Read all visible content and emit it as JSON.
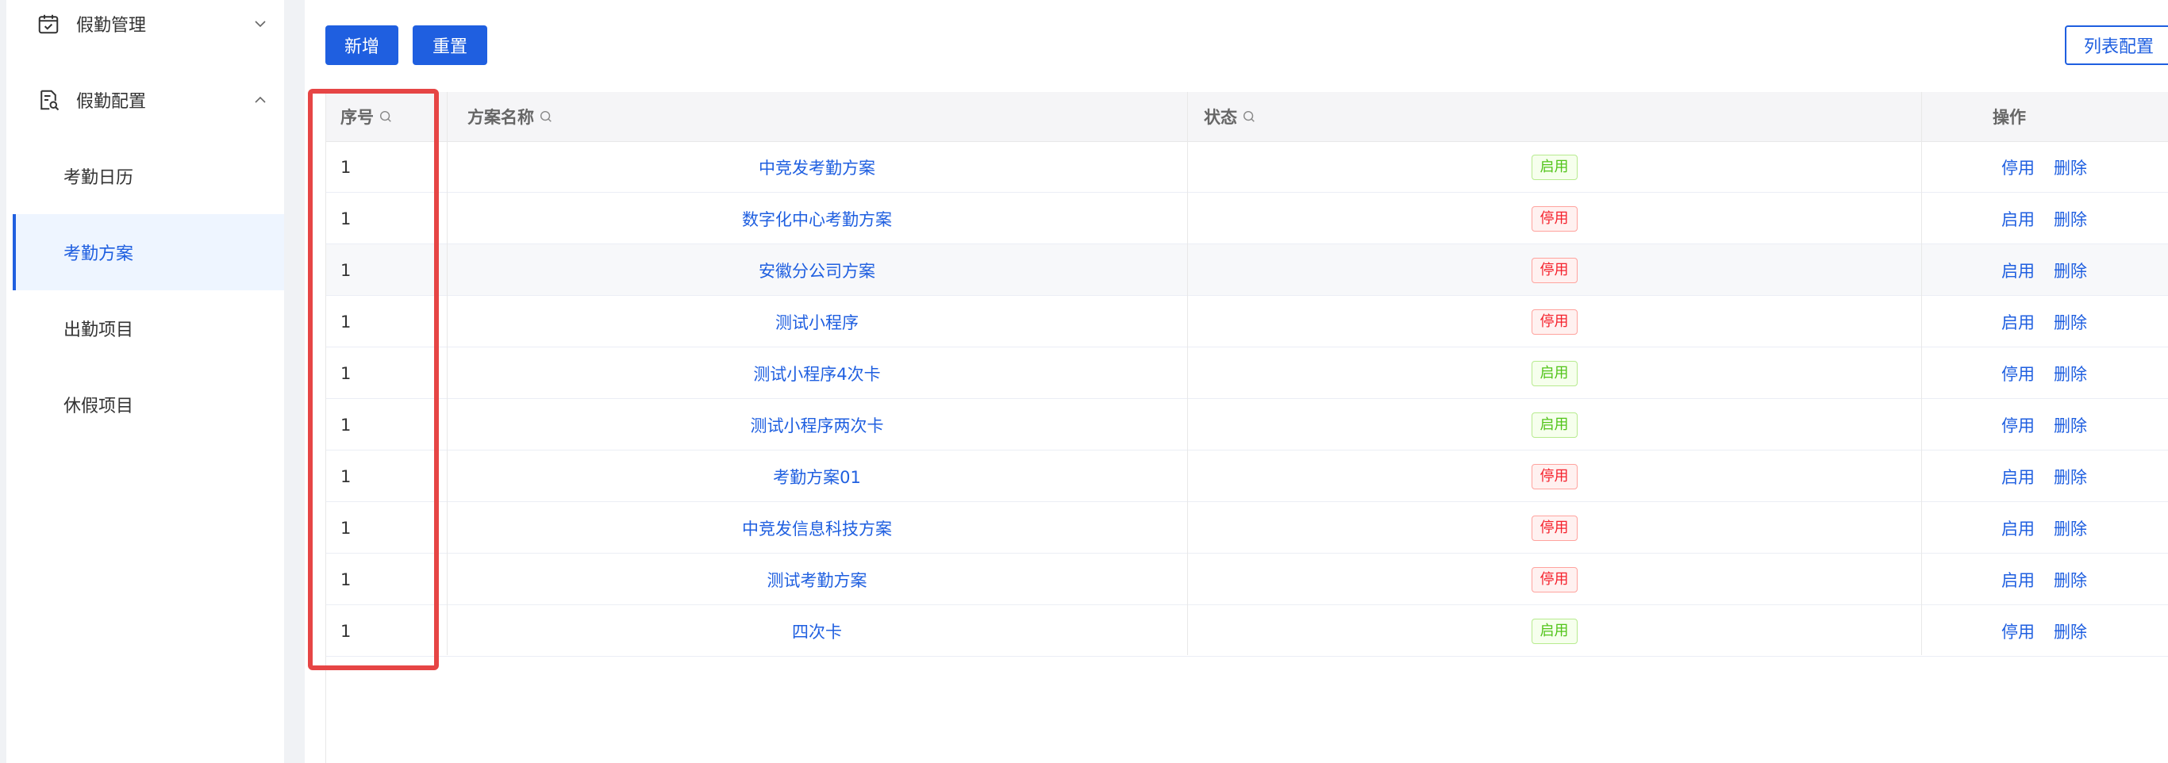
{
  "sidebar": {
    "groups": [
      {
        "label": "假勤管理",
        "icon": "calendar-check-icon",
        "chevron": "chevron-down-icon"
      },
      {
        "label": "假勤配置",
        "icon": "document-search-icon",
        "chevron": "chevron-up-icon"
      }
    ],
    "items": [
      {
        "label": "考勤日历",
        "active": false
      },
      {
        "label": "考勤方案",
        "active": true
      },
      {
        "label": "出勤项目",
        "active": false
      },
      {
        "label": "休假项目",
        "active": false
      }
    ]
  },
  "toolbar": {
    "add_label": "新增",
    "reset_label": "重置",
    "list_config_label": "列表配置"
  },
  "table": {
    "headers": {
      "seq": "序号",
      "name": "方案名称",
      "status": "状态",
      "ops": "操作"
    },
    "rows": [
      {
        "seq": "1",
        "name": "中竞发考勤方案",
        "status": "启用",
        "status_on": true,
        "toggle": "停用",
        "del": "删除"
      },
      {
        "seq": "1",
        "name": "数字化中心考勤方案",
        "status": "停用",
        "status_on": false,
        "toggle": "启用",
        "del": "删除"
      },
      {
        "seq": "1",
        "name": "安徽分公司方案",
        "status": "停用",
        "status_on": false,
        "toggle": "启用",
        "del": "删除"
      },
      {
        "seq": "1",
        "name": "测试小程序",
        "status": "停用",
        "status_on": false,
        "toggle": "启用",
        "del": "删除"
      },
      {
        "seq": "1",
        "name": "测试小程序4次卡",
        "status": "启用",
        "status_on": true,
        "toggle": "停用",
        "del": "删除"
      },
      {
        "seq": "1",
        "name": "测试小程序两次卡",
        "status": "启用",
        "status_on": true,
        "toggle": "停用",
        "del": "删除"
      },
      {
        "seq": "1",
        "name": "考勤方案01",
        "status": "停用",
        "status_on": false,
        "toggle": "启用",
        "del": "删除"
      },
      {
        "seq": "1",
        "name": "中竞发信息科技方案",
        "status": "停用",
        "status_on": false,
        "toggle": "启用",
        "del": "删除"
      },
      {
        "seq": "1",
        "name": "测试考勤方案",
        "status": "停用",
        "status_on": false,
        "toggle": "启用",
        "del": "删除"
      },
      {
        "seq": "1",
        "name": "四次卡",
        "status": "启用",
        "status_on": true,
        "toggle": "停用",
        "del": "删除"
      }
    ]
  },
  "colors": {
    "primary": "#1f5fe0",
    "enabled_tag": "#52c41a",
    "disabled_tag": "#f5222d",
    "highlight_box": "#e64545"
  }
}
